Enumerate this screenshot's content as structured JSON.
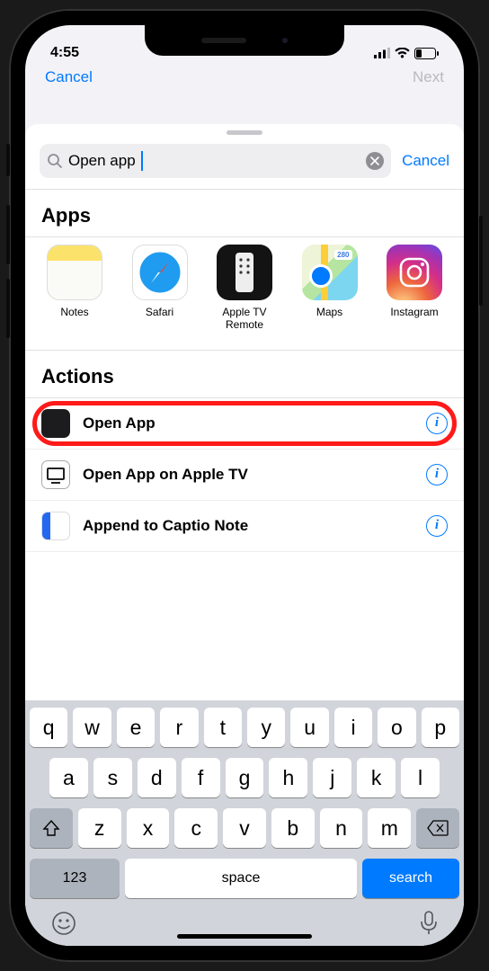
{
  "status": {
    "time": "4:55"
  },
  "peek": {
    "cancel": "Cancel",
    "next": "Next"
  },
  "search": {
    "value": "Open app",
    "cancel": "Cancel"
  },
  "sections": {
    "apps": "Apps",
    "actions": "Actions"
  },
  "apps": [
    {
      "name": "Notes"
    },
    {
      "name": "Safari"
    },
    {
      "name": "Apple TV Remote"
    },
    {
      "name": "Maps"
    },
    {
      "name": "Instagram"
    }
  ],
  "actions": [
    {
      "label": "Open App"
    },
    {
      "label": "Open App on Apple TV"
    },
    {
      "label": "Append to Captio Note"
    }
  ],
  "keyboard": {
    "rows": [
      [
        "q",
        "w",
        "e",
        "r",
        "t",
        "y",
        "u",
        "i",
        "o",
        "p"
      ],
      [
        "a",
        "s",
        "d",
        "f",
        "g",
        "h",
        "j",
        "k",
        "l"
      ],
      [
        "z",
        "x",
        "c",
        "v",
        "b",
        "n",
        "m"
      ]
    ],
    "num": "123",
    "space": "space",
    "search": "search"
  }
}
